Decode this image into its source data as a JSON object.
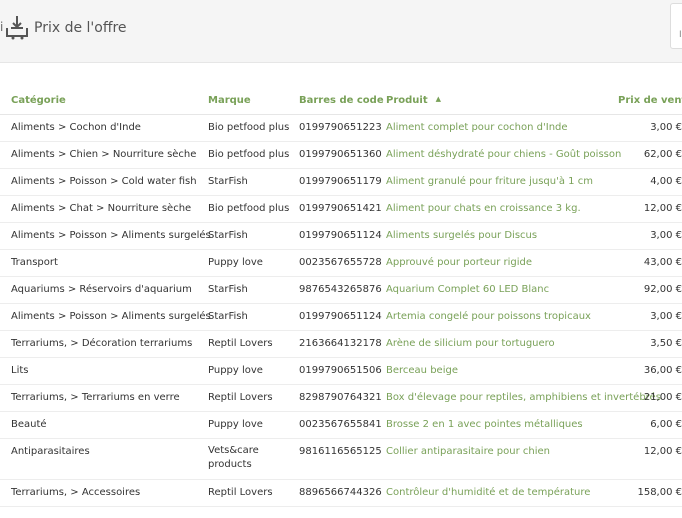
{
  "header": {
    "left_cut": "i",
    "title": "Prix de l'offre",
    "right_cut": "In"
  },
  "columns": {
    "category": "Catégorie",
    "brand": "Marque",
    "barcode": "Barres de code",
    "product": "Produit",
    "sort_indicator": "▲",
    "price": "Prix de vente d"
  },
  "rows": [
    {
      "category": "Aliments > Cochon d'Inde",
      "brand": "Bio petfood plus",
      "barcode": "0199790651223",
      "product": "Aliment complet pour cochon d'Inde",
      "price": "3,00 €"
    },
    {
      "category": "Aliments > Chien > Nourriture sèche",
      "brand": "Bio petfood plus",
      "barcode": "0199790651360",
      "product": "Aliment déshydraté pour chiens - Goût poisson",
      "price": "62,00 €"
    },
    {
      "category": "Aliments > Poisson > Cold water fish",
      "brand": "StarFish",
      "barcode": "0199790651179",
      "product": "Aliment granulé pour friture jusqu'à 1 cm",
      "price": "4,00 €"
    },
    {
      "category": "Aliments > Chat > Nourriture sèche",
      "brand": "Bio petfood plus",
      "barcode": "0199790651421",
      "product": "Aliment pour chats en croissance 3 kg.",
      "price": "12,00 €"
    },
    {
      "category": "Aliments > Poisson > Aliments surgelés",
      "brand": "StarFish",
      "barcode": "0199790651124",
      "product": "Aliments surgelés pour Discus",
      "price": "3,00 €"
    },
    {
      "category": "Transport",
      "brand": "Puppy love",
      "barcode": "0023567655728",
      "product": "Approuvé pour porteur rigide",
      "price": "43,00 €"
    },
    {
      "category": "Aquariums > Réservoirs d'aquarium",
      "brand": "StarFish",
      "barcode": "9876543265876",
      "product": "Aquarium Complet 60 LED Blanc",
      "price": "92,00 €"
    },
    {
      "category": "Aliments > Poisson > Aliments surgelés",
      "brand": "StarFish",
      "barcode": "0199790651124",
      "product": "Artemia congelé pour poissons tropicaux",
      "price": "3,00 €"
    },
    {
      "category": "Terrariums, > Décoration terrariums",
      "brand": "Reptil Lovers",
      "barcode": "2163664132178",
      "product": "Arène de silicium pour tortuguero",
      "price": "3,50 €"
    },
    {
      "category": "Lits",
      "brand": "Puppy love",
      "barcode": "0199790651506",
      "product": "Berceau beige",
      "price": "36,00 €"
    },
    {
      "category": "Terrariums, > Terrariums en verre",
      "brand": "Reptil Lovers",
      "barcode": "8298790764321",
      "product": "Box d'élevage pour reptiles, amphibiens et invertébrés",
      "price": "21,00 €"
    },
    {
      "category": "Beauté",
      "brand": "Puppy love",
      "barcode": "0023567655841",
      "product": "Brosse 2 en 1 avec pointes métalliques",
      "price": "6,00 €"
    },
    {
      "category": "Antiparasitaires",
      "brand": "Vets&care products",
      "barcode": "9816116565125",
      "product": "Collier antiparasitaire pour chien",
      "price": "12,00 €"
    },
    {
      "category": "Terrariums, > Accessoires",
      "brand": "Reptil Lovers",
      "barcode": "8896566744326",
      "product": "Contrôleur d'humidité et de température",
      "price": "158,00 €"
    }
  ]
}
